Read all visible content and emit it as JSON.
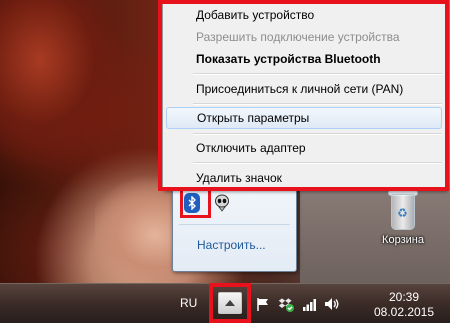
{
  "context_menu": {
    "items": [
      {
        "label": "Добавить устройство",
        "state": "normal"
      },
      {
        "label": "Разрешить подключение устройства",
        "state": "disabled"
      },
      {
        "label": "Показать устройства Bluetooth",
        "state": "bold"
      },
      {
        "label": "Присоединиться к личной сети (PAN)",
        "state": "normal"
      },
      {
        "label": "Открыть параметры",
        "state": "highlighted"
      },
      {
        "label": "Отключить адаптер",
        "state": "normal"
      },
      {
        "label": "Удалить значок",
        "state": "normal"
      }
    ]
  },
  "tray_popup": {
    "icons": [
      "bluetooth-icon",
      "alien-skull-icon"
    ],
    "customize_link": "Настроить..."
  },
  "desktop": {
    "recycle_bin_label": "Корзина"
  },
  "taskbar": {
    "language": "RU",
    "tray_icons": [
      "show-hidden-icons-arrow",
      "action-center-flag-icon",
      "dropbox-sync-icon",
      "network-signal-icon",
      "volume-icon"
    ],
    "clock_time": "20:39",
    "clock_date": "08.02.2015"
  },
  "colors": {
    "highlight_red": "#e8121c",
    "link_blue": "#1e5a9c",
    "bluetooth_blue": "#1f5fbf"
  }
}
